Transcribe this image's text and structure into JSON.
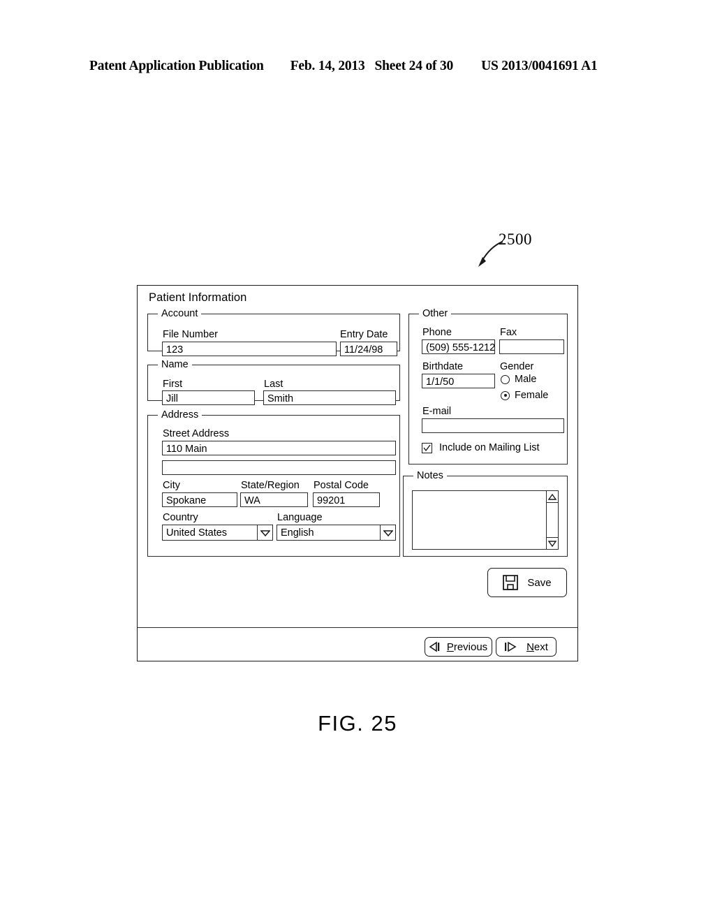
{
  "patent_header": {
    "publication": "Patent Application Publication",
    "date": "Feb. 14, 2013",
    "sheet": "Sheet 24 of 30",
    "number": "US 2013/0041691 A1"
  },
  "figure": {
    "caption": "FIG. 25",
    "reference_numeral": "2500"
  },
  "dialog": {
    "title": "Patient Information",
    "account": {
      "legend": "Account",
      "file_number_label": "File Number",
      "file_number_value": "123",
      "entry_date_label": "Entry Date",
      "entry_date_value": "11/24/98"
    },
    "name": {
      "legend": "Name",
      "first_label": "First",
      "first_value": "Jill",
      "last_label": "Last",
      "last_value": "Smith"
    },
    "address": {
      "legend": "Address",
      "street_label": "Street Address",
      "street_line1_value": "110 Main",
      "street_line2_value": "",
      "city_label": "City",
      "city_value": "Spokane",
      "state_label": "State/Region",
      "state_value": "WA",
      "postal_label": "Postal Code",
      "postal_value": "99201",
      "country_label": "Country",
      "country_value": "United States",
      "language_label": "Language",
      "language_value": "English"
    },
    "other": {
      "legend": "Other",
      "phone_label": "Phone",
      "phone_value": "(509) 555-1212",
      "fax_label": "Fax",
      "fax_value": "",
      "birthdate_label": "Birthdate",
      "birthdate_value": "1/1/50",
      "gender_label": "Gender",
      "gender_male_label": "Male",
      "gender_female_label": "Female",
      "gender_selected": "Female",
      "email_label": "E-mail",
      "email_value": "",
      "mailing_list_label": "Include on Mailing List",
      "mailing_list_checked": true
    },
    "notes": {
      "legend": "Notes",
      "value": ""
    },
    "buttons": {
      "save_label": "Save",
      "previous_label": "Previous",
      "next_label": "Next"
    }
  }
}
